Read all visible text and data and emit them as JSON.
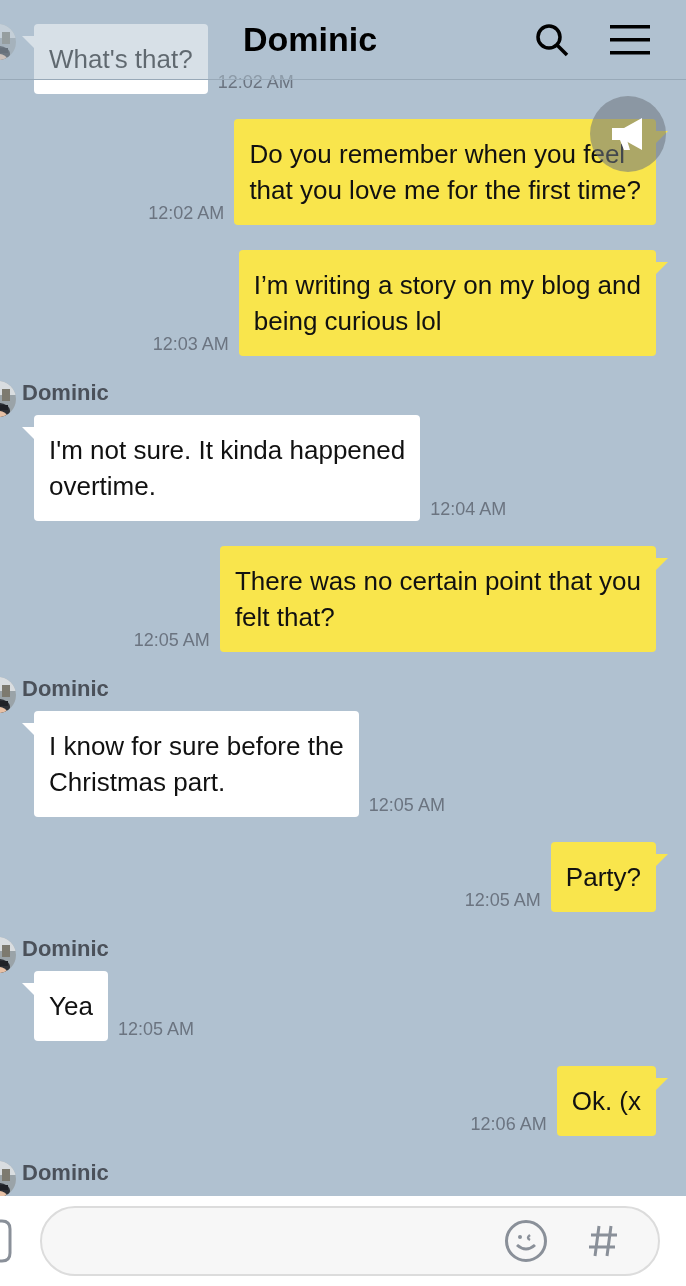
{
  "header": {
    "title": "Dominic"
  },
  "messages": [
    {
      "kind": "incoming",
      "text": "What's that?",
      "time": "12:02 AM"
    },
    {
      "kind": "outgoing",
      "text": "Do you remember when you feel\nthat you love me for the first time?",
      "time": "12:02 AM"
    },
    {
      "kind": "outgoing",
      "text": "I’m writing a story on my blog and\nbeing curious lol",
      "time": "12:03 AM"
    },
    {
      "kind": "incoming",
      "sender": "Dominic",
      "text": "I'm not sure. It kinda happened\novertime.",
      "time": "12:04 AM"
    },
    {
      "kind": "outgoing",
      "text": "There was no certain point that you\nfelt that?",
      "time": "12:05 AM"
    },
    {
      "kind": "incoming",
      "sender": "Dominic",
      "text": "I know for sure before the\nChristmas part.",
      "time": "12:05 AM"
    },
    {
      "kind": "outgoing",
      "text": "Party?",
      "time": "12:05 AM"
    },
    {
      "kind": "incoming",
      "sender": "Dominic",
      "text": "Yea",
      "time": "12:05 AM"
    },
    {
      "kind": "outgoing",
      "text": "Ok. (x",
      "time": "12:06 AM"
    },
    {
      "kind": "incoming",
      "sender": "Dominic"
    }
  ]
}
